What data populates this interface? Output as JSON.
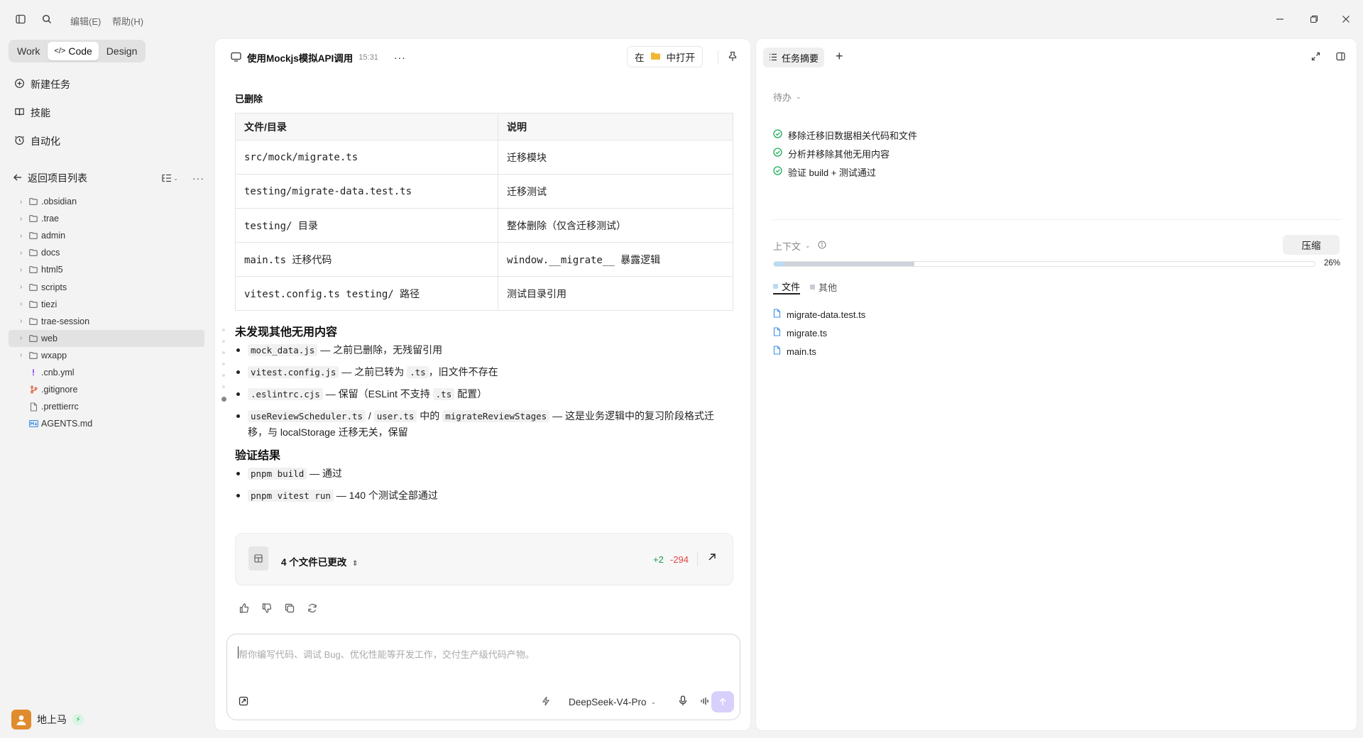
{
  "menu": {
    "edit": "编辑(E)",
    "help": "帮助(H)"
  },
  "modes": [
    {
      "label": "Work"
    },
    {
      "label": "Code"
    },
    {
      "label": "Design"
    }
  ],
  "nav": {
    "new_task": "新建任务",
    "skills": "技能",
    "automation": "自动化"
  },
  "project": {
    "back_label": "返回项目列表",
    "tree": [
      {
        "name": ".obsidian",
        "type": "folder"
      },
      {
        "name": ".trae",
        "type": "folder"
      },
      {
        "name": "admin",
        "type": "folder"
      },
      {
        "name": "docs",
        "type": "folder"
      },
      {
        "name": "html5",
        "type": "folder"
      },
      {
        "name": "scripts",
        "type": "folder"
      },
      {
        "name": "tiezi",
        "type": "folder"
      },
      {
        "name": "trae-session",
        "type": "folder"
      },
      {
        "name": "web",
        "type": "folder",
        "selected": true
      },
      {
        "name": "wxapp",
        "type": "folder"
      },
      {
        "name": ".cnb.yml",
        "type": "file",
        "icon": "exclamation-icon"
      },
      {
        "name": ".gitignore",
        "type": "file",
        "icon": "git-icon"
      },
      {
        "name": ".prettierrc",
        "type": "file",
        "icon": "file-icon"
      },
      {
        "name": "AGENTS.md",
        "type": "file",
        "icon": "markdown-icon"
      }
    ]
  },
  "user": {
    "name": "地上马"
  },
  "chat": {
    "title": "使用Mockjs模拟API调用",
    "time": "15:31",
    "open_in_prefix": "在",
    "open_in_suffix": "中打开",
    "deleted_heading": "已删除",
    "table": {
      "headers": [
        "文件/目录",
        "说明"
      ],
      "rows": [
        [
          "src/mock/migrate.ts",
          "迁移模块"
        ],
        [
          "testing/migrate-data.test.ts",
          "迁移测试"
        ],
        [
          "testing/ 目录",
          "整体删除（仅含迁移测试）"
        ],
        [
          "main.ts 迁移代码",
          "window.__migrate__ 暴露逻辑"
        ],
        [
          "vitest.config.ts testing/ 路径",
          "测试目录引用"
        ]
      ]
    },
    "section1_title": "未发现其他无用内容",
    "section1_items": [
      {
        "code": "mock_data.js",
        "text": " — 之前已删除，无残留引用"
      },
      {
        "code": "vitest.config.js",
        "text": " — 之前已转为 ",
        "code2": ".ts",
        "text2": "，旧文件不存在"
      },
      {
        "code": ".eslintrc.cjs",
        "text": " — 保留（ESLint 不支持 ",
        "code2": ".ts",
        "text2": " 配置）"
      },
      {
        "code": "useReviewScheduler.ts",
        "text": " / ",
        "code2": "user.ts",
        "text2": " 中的 ",
        "code3": "migrateReviewStages",
        "text3": " — 这是业务逻辑中的复习阶段格式迁移，与 localStorage 迁移无关，保留"
      }
    ],
    "section2_title": "验证结果",
    "section2_items": [
      {
        "code": "pnpm build",
        "text": " — 通过"
      },
      {
        "code": "pnpm vitest run",
        "text": " — 140 个测试全部通过"
      }
    ],
    "changes": {
      "label": "4 个文件已更改",
      "added": "+2",
      "removed": "-294"
    },
    "composer_placeholder": "帮你编写代码、调试 Bug、优化性能等开发工作，交付生产级代码产物。",
    "model": "DeepSeek-V4-Pro"
  },
  "right": {
    "tab_label": "任务摘要",
    "todo_heading": "待办",
    "todos": [
      "移除迁移旧数据相关代码和文件",
      "分析并移除其他无用内容",
      "验证 build + 测试通过"
    ],
    "context_heading": "上下文",
    "compress_label": "压缩",
    "context_usage": 0.26,
    "context_usage_label": "26%",
    "file_tabs": [
      "文件",
      "其他"
    ],
    "files": [
      "migrate-data.test.ts",
      "migrate.ts",
      "main.ts"
    ]
  },
  "colors": {
    "accent_send": "#d8d0fb",
    "check_green": "#1fae5b",
    "added_green": "#1a9b4b",
    "removed_red": "#e04545",
    "file_blue": "#3b8ee8"
  }
}
